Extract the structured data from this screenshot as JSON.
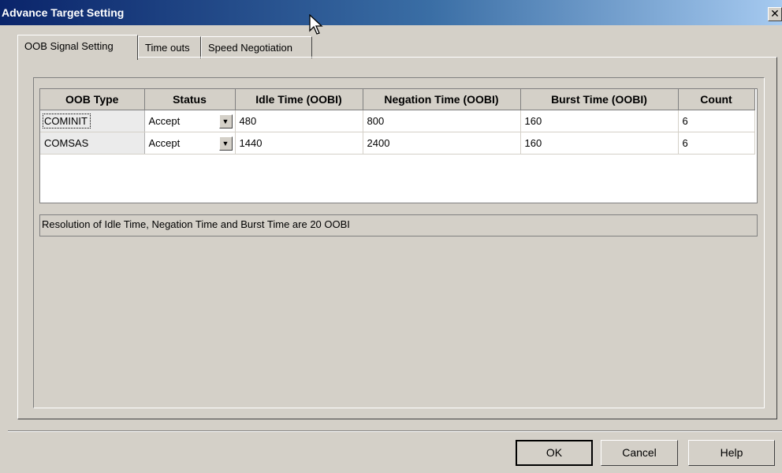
{
  "window": {
    "title": "Advance Target Setting",
    "close_glyph": "✕"
  },
  "tabs": [
    {
      "label": "OOB Signal Setting",
      "active": true
    },
    {
      "label": "Time outs",
      "active": false
    },
    {
      "label": "Speed Negotiation",
      "active": false
    }
  ],
  "table": {
    "columns": [
      "OOB Type",
      "Status",
      "Idle Time (OOBI)",
      "Negation Time (OOBI)",
      "Burst Time (OOBI)",
      "Count"
    ],
    "rows": [
      {
        "oob_type": "COMINIT",
        "status": "Accept",
        "idle": "480",
        "negation": "800",
        "burst": "160",
        "count": "6"
      },
      {
        "oob_type": "COMSAS",
        "status": "Accept",
        "idle": "1440",
        "negation": "2400",
        "burst": "160",
        "count": "6"
      }
    ]
  },
  "note": "Resolution of Idle Time, Negation Time and Burst Time are 20 OOBI",
  "buttons": {
    "ok": "OK",
    "cancel": "Cancel",
    "help": "Help"
  },
  "icons": {
    "dropdown": "chevron-down-icon",
    "close": "close-icon",
    "cursor": "mouse-pointer-icon"
  }
}
